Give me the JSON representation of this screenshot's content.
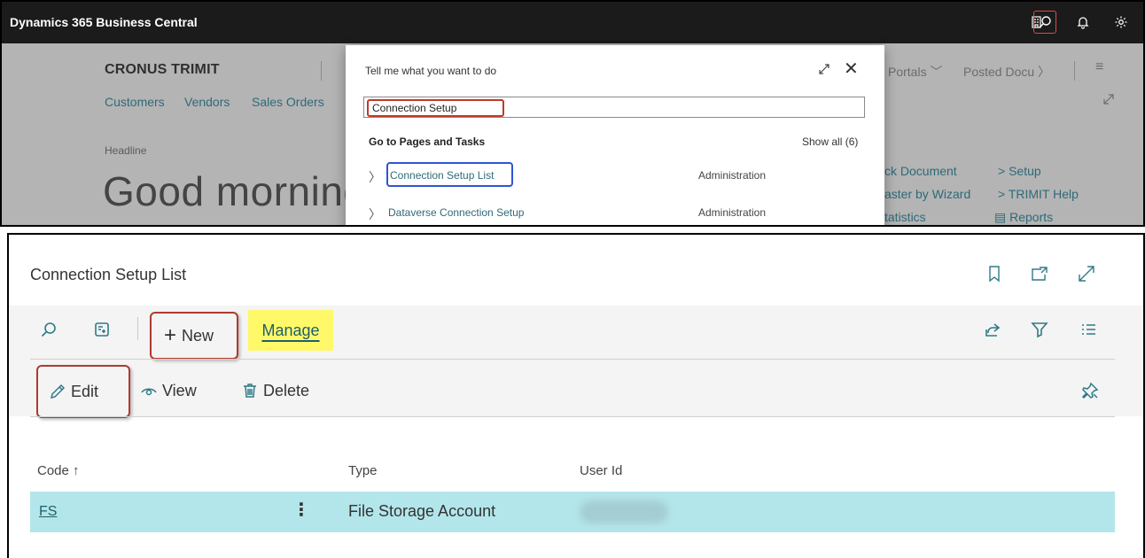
{
  "app": {
    "title": "Dynamics 365 Business Central"
  },
  "appbar_icons": [
    "company-icon",
    "search-icon",
    "bell-icon",
    "gear-icon"
  ],
  "home": {
    "company": "CRONUS TRIMIT",
    "nav": [
      "Customers",
      "Vendors",
      "Sales Orders"
    ],
    "nav_right": [
      "Portals",
      "Posted Docu"
    ],
    "headline_label": "Headline",
    "greeting": "Good morning",
    "actions": [
      "ck Document",
      "aster by Wizard",
      "tatistics",
      "Setup",
      "TRIMIT Help",
      "Reports"
    ]
  },
  "search": {
    "prompt": "Tell me what you want to do",
    "query": "Connection Setup",
    "section_title": "Go to Pages and Tasks",
    "show_all": "Show all (6)",
    "results": [
      {
        "label": "Connection Setup List",
        "category": "Administration"
      },
      {
        "label": "Dataverse Connection Setup",
        "category": "Administration"
      }
    ]
  },
  "list": {
    "title": "Connection Setup List",
    "toolbar": {
      "new_label": "New",
      "manage_label": "Manage"
    },
    "actions": {
      "edit_label": "Edit",
      "view_label": "View",
      "delete_label": "Delete"
    },
    "columns": [
      "Code",
      "Type",
      "User Id"
    ],
    "sort_indicator": "↑",
    "rows": [
      {
        "code": "FS",
        "type": "File Storage Account",
        "user_id": ""
      }
    ]
  },
  "colors": {
    "accent": "#2e7a86",
    "appbar": "#1b1b1b",
    "highlight": "#fff96a",
    "selected_row": "#b3e6ea",
    "callout_red": "#b03a2e",
    "callout_blue": "#2f55d4"
  }
}
